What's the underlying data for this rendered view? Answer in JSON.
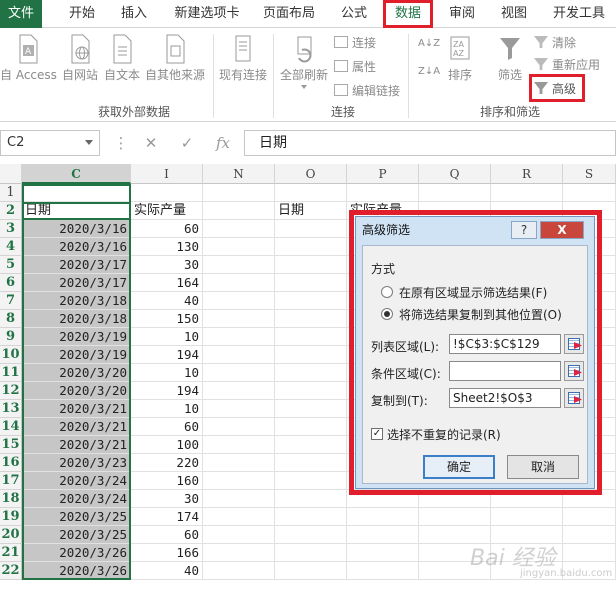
{
  "tabs": [
    "文件",
    "开始",
    "插入",
    "新建选项卡",
    "页面布局",
    "公式",
    "数据",
    "审阅",
    "视图",
    "开发工具"
  ],
  "ribbon": {
    "external": {
      "buttons": [
        "自 Access",
        "自网站",
        "自文本",
        "自其他来源",
        "现有连接"
      ],
      "label": "获取外部数据"
    },
    "connections": {
      "refresh_all": "全部刷新",
      "items": [
        "连接",
        "属性",
        "编辑链接"
      ],
      "label": "连接"
    },
    "sort_filter": {
      "sort": "排序",
      "filter": "筛选",
      "clear": "清除",
      "reapply": "重新应用",
      "advanced": "高级",
      "label": "排序和筛选"
    }
  },
  "formula_bar": {
    "name_box": "C2",
    "content": "日期"
  },
  "grid": {
    "columns": [
      "C",
      "I",
      "N",
      "O",
      "P",
      "Q",
      "R",
      "S"
    ],
    "row_numbers": [
      "1",
      "2",
      "3",
      "4",
      "5",
      "6",
      "7",
      "8",
      "9",
      "10",
      "11",
      "12",
      "13",
      "14",
      "15",
      "16",
      "17",
      "18",
      "19",
      "20",
      "21",
      "22"
    ],
    "header_row": {
      "c": "日期",
      "i": "实际产量",
      "o": "日期",
      "p": "实际产量"
    },
    "rows": [
      {
        "date": "2020/3/16",
        "qty": "60"
      },
      {
        "date": "2020/3/16",
        "qty": "130"
      },
      {
        "date": "2020/3/17",
        "qty": "30"
      },
      {
        "date": "2020/3/17",
        "qty": "164"
      },
      {
        "date": "2020/3/18",
        "qty": "40"
      },
      {
        "date": "2020/3/18",
        "qty": "150"
      },
      {
        "date": "2020/3/19",
        "qty": "10"
      },
      {
        "date": "2020/3/19",
        "qty": "194"
      },
      {
        "date": "2020/3/20",
        "qty": "10"
      },
      {
        "date": "2020/3/20",
        "qty": "194"
      },
      {
        "date": "2020/3/21",
        "qty": "10"
      },
      {
        "date": "2020/3/21",
        "qty": "60"
      },
      {
        "date": "2020/3/21",
        "qty": "100"
      },
      {
        "date": "2020/3/23",
        "qty": "220"
      },
      {
        "date": "2020/3/24",
        "qty": "160"
      },
      {
        "date": "2020/3/24",
        "qty": "30"
      },
      {
        "date": "2020/3/25",
        "qty": "174"
      },
      {
        "date": "2020/3/25",
        "qty": "60"
      },
      {
        "date": "2020/3/26",
        "qty": "166"
      },
      {
        "date": "2020/3/26",
        "qty": "40"
      }
    ]
  },
  "dialog": {
    "title": "高级筛选",
    "help": "?",
    "close": "X",
    "method_label": "方式",
    "option_inplace": "在原有区域显示筛选结果(F)",
    "option_copy": "将筛选结果复制到其他位置(O)",
    "list_range_label": "列表区域(L):",
    "list_range_value": "!$C$3:$C$129",
    "criteria_label": "条件区域(C):",
    "criteria_value": "",
    "copy_to_label": "复制到(T):",
    "copy_to_value": "Sheet2!$O$3",
    "unique_label": "选择不重复的记录(R)",
    "unique_checked": true,
    "ok": "确定",
    "cancel": "取消"
  },
  "watermark": {
    "main": "Bai 经验",
    "sub": "jingyan.baidu.com"
  },
  "colors": {
    "excel_green": "#217346",
    "highlight_red": "#e01e2c",
    "column_selection": "#c6c6c6"
  }
}
